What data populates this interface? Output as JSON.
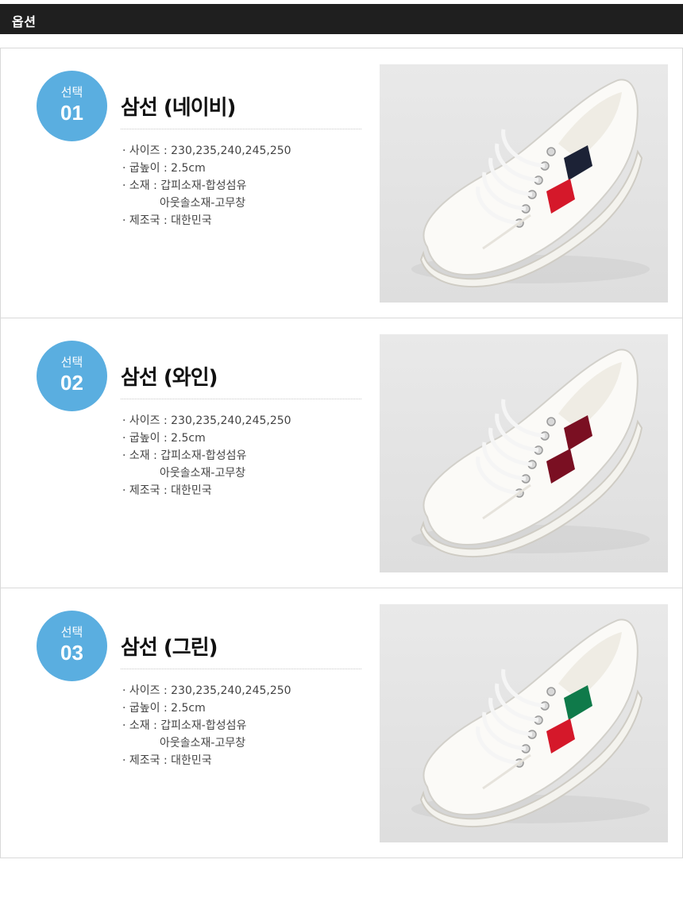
{
  "header": {
    "title": "옵션"
  },
  "options": [
    {
      "badge_label": "선택",
      "badge_number": "01",
      "title": "삼선 (네이비)",
      "specs": {
        "size": "· 사이즈 : 230,235,240,245,250",
        "heel": "· 굽높이 : 2.5cm",
        "material": "· 소재 : 갑피소재-합성섬유",
        "material_cont": "아웃솔소재-고무창",
        "origin": "· 제조국 : 대한민국"
      },
      "stripe_colors": {
        "top": "#1c2236",
        "bottom": "#d5182a"
      },
      "image": "navy-stripe-canvas-sneaker"
    },
    {
      "badge_label": "선택",
      "badge_number": "02",
      "title": "삼선 (와인)",
      "specs": {
        "size": "· 사이즈 : 230,235,240,245,250",
        "heel": "· 굽높이 : 2.5cm",
        "material": "· 소재 : 갑피소재-합성섬유",
        "material_cont": "아웃솔소재-고무창",
        "origin": "· 제조국 : 대한민국"
      },
      "stripe_colors": {
        "top": "#7a0f22",
        "bottom": "#7a0f22"
      },
      "image": "wine-stripe-canvas-sneaker"
    },
    {
      "badge_label": "선택",
      "badge_number": "03",
      "title": "삼선 (그린)",
      "specs": {
        "size": "· 사이즈 : 230,235,240,245,250",
        "heel": "· 굽높이 : 2.5cm",
        "material": "· 소재 : 갑피소재-합성섬유",
        "material_cont": "아웃솔소재-고무창",
        "origin": "· 제조국 : 대한민국"
      },
      "stripe_colors": {
        "top": "#0f7a4a",
        "bottom": "#d5182a"
      },
      "image": "green-stripe-canvas-sneaker"
    }
  ]
}
